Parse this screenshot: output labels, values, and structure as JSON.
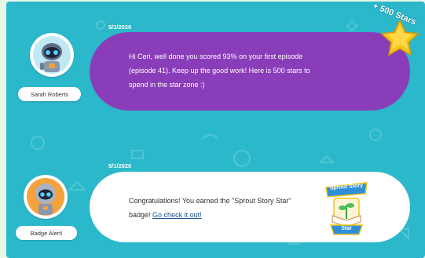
{
  "messages": [
    {
      "date": "5/1/2020",
      "sender": "Sarah Roberts",
      "text": "Hi Ceri, well done you scored 93% on your first episode (episode 41). Keep up the good work! Here is 500 stars to spend in the star zone :)",
      "line1": "Hi Ceri, well done you scored 93% on your first episode",
      "line2": "(episode 41). Keep up the good work! Here is 500 stars to",
      "line3": "spend in the star zone :)",
      "reward_label": "+ 500 Stars"
    },
    {
      "date": "5/1/2020",
      "sender": "Badge Alert!",
      "line1": "Congratulations! You earned the \"Sprout Story Star\"",
      "line2_prefix": "badge!",
      "link_text": "Go check it out!",
      "badge_top": "Sprout Story",
      "badge_bottom": "Star"
    }
  ],
  "colors": {
    "background": "#2bb8cb",
    "bubble_purple": "#8a3db8",
    "bubble_white": "#ffffff",
    "star_gold": "#f5c518"
  }
}
